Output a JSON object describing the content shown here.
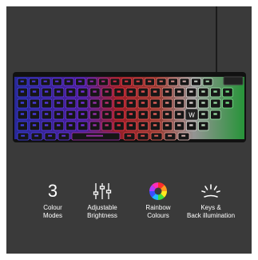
{
  "product_image": {
    "description_icon": "keyboard-photo",
    "badge_text": "W"
  },
  "features": [
    {
      "icon": "number",
      "value": "3",
      "line1": "Colour",
      "line2": "Modes"
    },
    {
      "icon": "sliders-icon",
      "line1": "Adjustable",
      "line2": "Brightness"
    },
    {
      "icon": "rainbow-wheel-icon",
      "line1": "Rainbow",
      "line2": "Colours"
    },
    {
      "icon": "backlight-key-icon",
      "line1": "Keys &",
      "line2": "Back illumination"
    }
  ],
  "colors": {
    "background": "#3a3a3a",
    "text": "#ffffff"
  }
}
